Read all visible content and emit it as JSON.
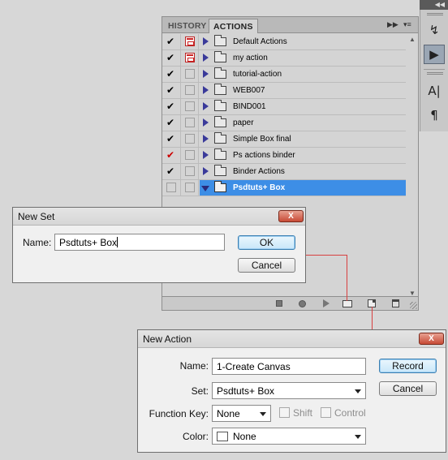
{
  "panel": {
    "tabs": [
      {
        "label": "HISTORY",
        "active": false
      },
      {
        "label": "ACTIONS",
        "active": true
      }
    ],
    "menu_icon": "panel-menu-icon",
    "rows": [
      {
        "name": "Default Actions",
        "checked": true,
        "check_color": "#000000",
        "dialog": true,
        "expanded": false,
        "selected": false
      },
      {
        "name": "my action",
        "checked": true,
        "check_color": "#000000",
        "dialog": true,
        "expanded": false,
        "selected": false
      },
      {
        "name": "tutorial-action",
        "checked": true,
        "check_color": "#000000",
        "dialog": false,
        "expanded": false,
        "selected": false
      },
      {
        "name": "WEB007",
        "checked": true,
        "check_color": "#000000",
        "dialog": false,
        "expanded": false,
        "selected": false
      },
      {
        "name": "BIND001",
        "checked": true,
        "check_color": "#000000",
        "dialog": false,
        "expanded": false,
        "selected": false
      },
      {
        "name": "paper",
        "checked": true,
        "check_color": "#000000",
        "dialog": false,
        "expanded": false,
        "selected": false
      },
      {
        "name": "Simple Box final",
        "checked": true,
        "check_color": "#000000",
        "dialog": false,
        "expanded": false,
        "selected": false
      },
      {
        "name": "Ps actions binder",
        "checked": true,
        "check_color": "#cc0000",
        "dialog": false,
        "expanded": false,
        "selected": false
      },
      {
        "name": "Binder Actions",
        "checked": true,
        "check_color": "#000000",
        "dialog": false,
        "expanded": false,
        "selected": false
      },
      {
        "name": "Psdtuts+ Box",
        "checked": false,
        "check_color": "#000000",
        "dialog": false,
        "expanded": true,
        "selected": true
      }
    ],
    "footer_icons": [
      "stop-icon",
      "record-icon",
      "play-icon",
      "new-set-icon",
      "new-action-icon",
      "delete-icon"
    ]
  },
  "dock": {
    "icons": [
      "history-brush-icon",
      "actions-play-icon",
      "character-icon",
      "paragraph-icon"
    ]
  },
  "new_set": {
    "title": "New Set",
    "close_label": "X",
    "name_label": "Name:",
    "name_value": "Psdtuts+ Box",
    "ok_label": "OK",
    "cancel_label": "Cancel"
  },
  "new_action": {
    "title": "New Action",
    "close_label": "X",
    "name_label": "Name:",
    "name_value": "1-Create Canvas",
    "set_label": "Set:",
    "set_value": "Psdtuts+ Box",
    "function_key_label": "Function Key:",
    "function_key_value": "None",
    "shift_label": "Shift",
    "control_label": "Control",
    "color_label": "Color:",
    "color_value": "None",
    "record_label": "Record",
    "cancel_label": "Cancel"
  },
  "colors": {
    "selection": "#3d8ee6",
    "close_button": "#c74a35",
    "connector": "#d84040"
  }
}
